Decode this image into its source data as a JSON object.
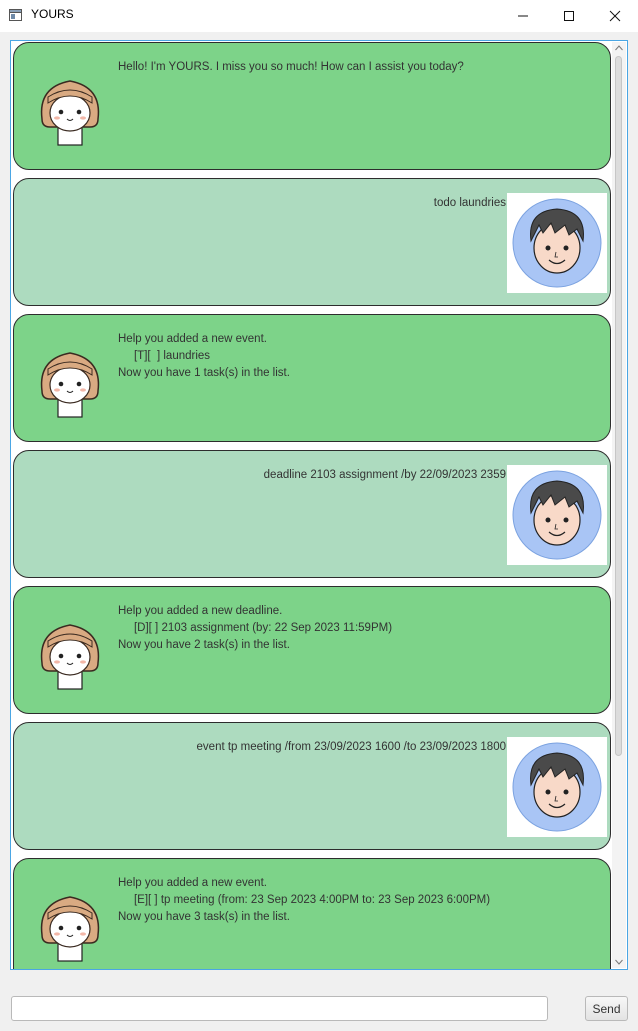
{
  "window": {
    "title": "YOURS",
    "minimize_icon": "minimize-icon",
    "maximize_icon": "maximize-icon",
    "close_icon": "close-icon"
  },
  "dialog": [
    {
      "sender": "bot",
      "text": "Hello! I'm YOURS. I miss you so much! How can I assist you today?"
    },
    {
      "sender": "user",
      "text": "todo laundries"
    },
    {
      "sender": "bot",
      "text": "Help you added a new event.\n     [T][  ] laundries\nNow you have 1 task(s) in the list."
    },
    {
      "sender": "user",
      "text": "deadline 2103 assignment /by 22/09/2023 2359"
    },
    {
      "sender": "bot",
      "text": "Help you added a new deadline.\n     [D][ ] 2103 assignment (by: 22 Sep 2023 11:59PM)\nNow you have 2 task(s) in the list."
    },
    {
      "sender": "user",
      "text": "event tp meeting /from 23/09/2023 1600 /to 23/09/2023 1800"
    },
    {
      "sender": "bot",
      "text": "Help you added a new event.\n     [E][ ] tp meeting (from: 23 Sep 2023 4:00PM to: 23 Sep 2023 6:00PM)\nNow you have 3 task(s) in the list."
    }
  ],
  "input": {
    "value": "",
    "placeholder": ""
  },
  "send_button": {
    "label": "Send"
  },
  "colors": {
    "bot_bubble": "#7dd389",
    "user_bubble": "#addbbf",
    "focus_border": "#4aa6e4"
  }
}
